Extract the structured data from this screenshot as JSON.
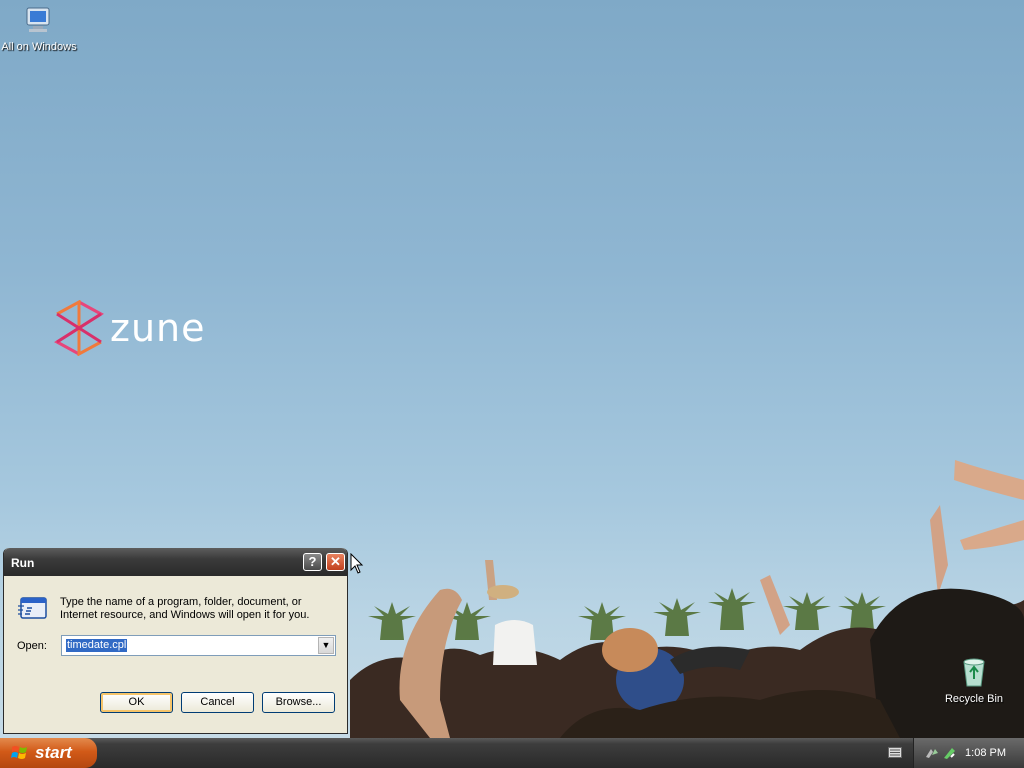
{
  "desktop": {
    "icons": [
      {
        "label": "All on Windows",
        "icon": "computer-icon"
      },
      {
        "label": "Recycle Bin",
        "icon": "recycle-bin-icon"
      }
    ],
    "logo_text": "zune"
  },
  "run_dialog": {
    "title": "Run",
    "help_label": "?",
    "close_label": "✕",
    "description": "Type the name of a program, folder, document, or Internet resource, and Windows will open it for you.",
    "open_label": "Open:",
    "open_value": "timedate.cpl",
    "ok_label": "OK",
    "cancel_label": "Cancel",
    "browse_label": "Browse..."
  },
  "taskbar": {
    "start_label": "start",
    "clock": "1:08 PM"
  },
  "colors": {
    "taskbar": "#2a2a2a",
    "start": "#d25a18",
    "dialog_bg": "#ece9d8"
  }
}
